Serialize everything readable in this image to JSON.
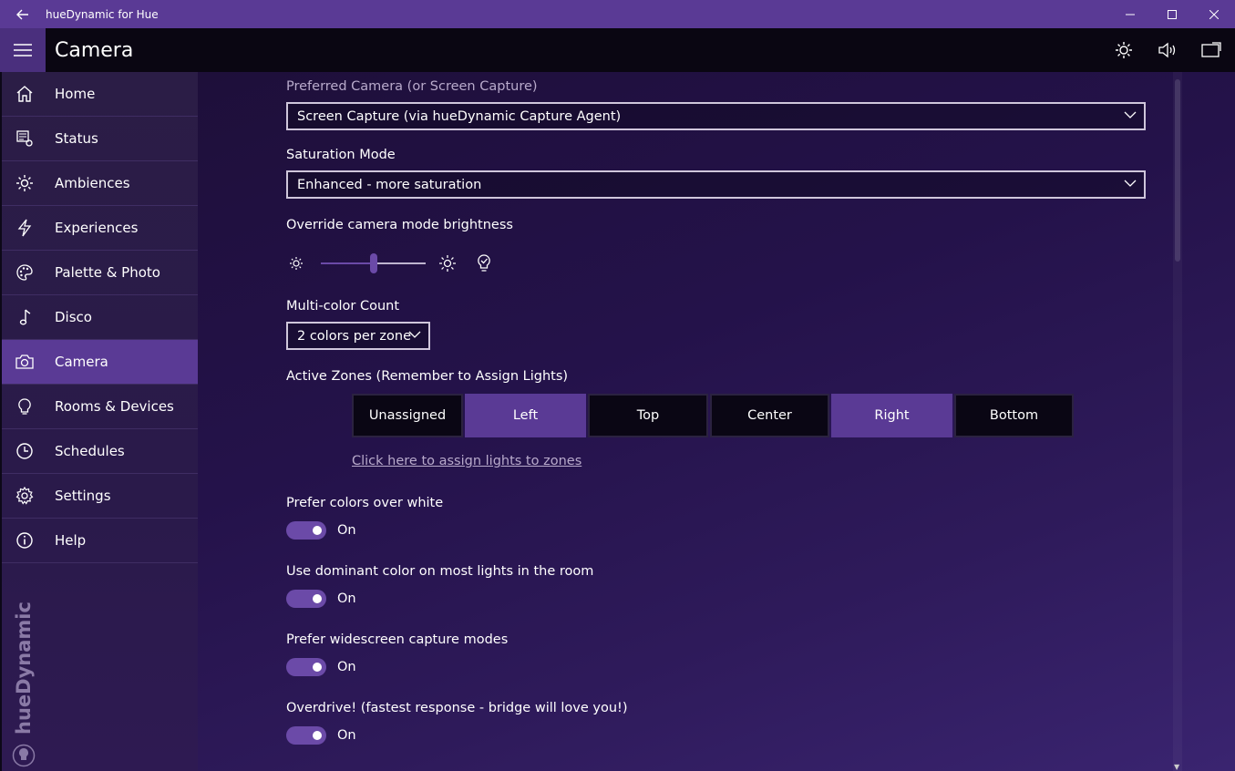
{
  "titlebar": {
    "title": "hueDynamic for Hue"
  },
  "header": {
    "title": "Camera"
  },
  "sidebar": {
    "items": [
      {
        "label": "Home",
        "icon": "home-icon"
      },
      {
        "label": "Status",
        "icon": "status-icon"
      },
      {
        "label": "Ambiences",
        "icon": "sun-icon"
      },
      {
        "label": "Experiences",
        "icon": "lightning-icon"
      },
      {
        "label": "Palette & Photo",
        "icon": "palette-icon"
      },
      {
        "label": "Disco",
        "icon": "music-note-icon"
      },
      {
        "label": "Camera",
        "icon": "camera-icon",
        "active": true
      },
      {
        "label": "Rooms & Devices",
        "icon": "bulb-icon"
      },
      {
        "label": "Schedules",
        "icon": "clock-icon"
      },
      {
        "label": "Settings",
        "icon": "gear-icon"
      },
      {
        "label": "Help",
        "icon": "info-icon"
      }
    ],
    "brand": "hueDynamic"
  },
  "main": {
    "preferred_camera_label": "Preferred Camera (or Screen Capture)",
    "preferred_camera_value": "Screen Capture (via hueDynamic Capture Agent)",
    "saturation_label": "Saturation Mode",
    "saturation_value": "Enhanced - more saturation",
    "brightness_label": "Override camera mode brightness",
    "brightness_level": 0.5,
    "multicolor_label": "Multi-color Count",
    "multicolor_value": "2 colors per zone",
    "zones_label": "Active Zones (Remember to Assign Lights)",
    "zones": [
      {
        "label": "Unassigned",
        "active": false
      },
      {
        "label": "Left",
        "active": true
      },
      {
        "label": "Top",
        "active": false
      },
      {
        "label": "Center",
        "active": false
      },
      {
        "label": "Right",
        "active": true
      },
      {
        "label": "Bottom",
        "active": false
      }
    ],
    "assign_link": "Click here to assign lights to zones",
    "toggles": [
      {
        "label": "Prefer colors over white",
        "state": "On"
      },
      {
        "label": "Use dominant color on most lights in the room",
        "state": "On"
      },
      {
        "label": "Prefer widescreen capture modes",
        "state": "On"
      },
      {
        "label": "Overdrive! (fastest response - bridge will love you!)",
        "state": "On"
      }
    ]
  },
  "colors": {
    "accent": "#5a3a95",
    "toggle": "#6b4aa8"
  }
}
